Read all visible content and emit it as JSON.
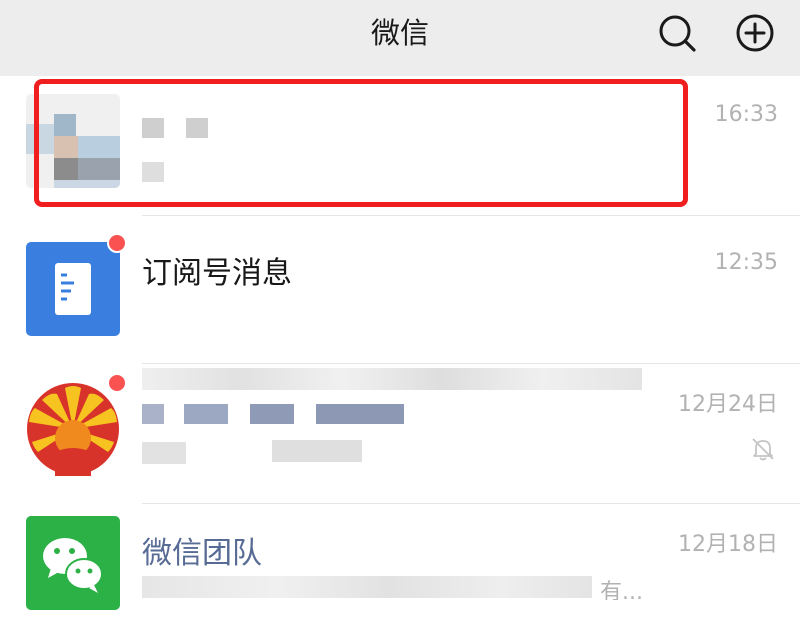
{
  "header": {
    "title": "微信",
    "search_icon": "search-icon",
    "add_icon": "plus-circle-icon"
  },
  "chats": [
    {
      "name": "",
      "time": "16:33",
      "preview": "",
      "avatar": "blurred-avatar",
      "unread": false,
      "muted": false,
      "highlighted": true
    },
    {
      "name": "订阅号消息",
      "time": "12:35",
      "preview": "",
      "avatar": "article-icon",
      "unread": true,
      "muted": false
    },
    {
      "name": "",
      "time": "12月24日",
      "preview": "",
      "avatar": "petrochina-logo",
      "unread": true,
      "muted": true,
      "mute_icon": "bell-off-icon"
    },
    {
      "name": "微信团队",
      "time": "12月18日",
      "preview": "有...",
      "avatar": "wechat-logo",
      "unread": false,
      "muted": false
    }
  ],
  "colors": {
    "header_bg": "#ededed",
    "badge": "#fa5151",
    "highlight_border": "#f01e1e",
    "subscription_blue": "#3a7fe0",
    "wechat_green": "#2bb146",
    "time_gray": "#b2b2b2",
    "official_name_blue": "#576b95"
  }
}
